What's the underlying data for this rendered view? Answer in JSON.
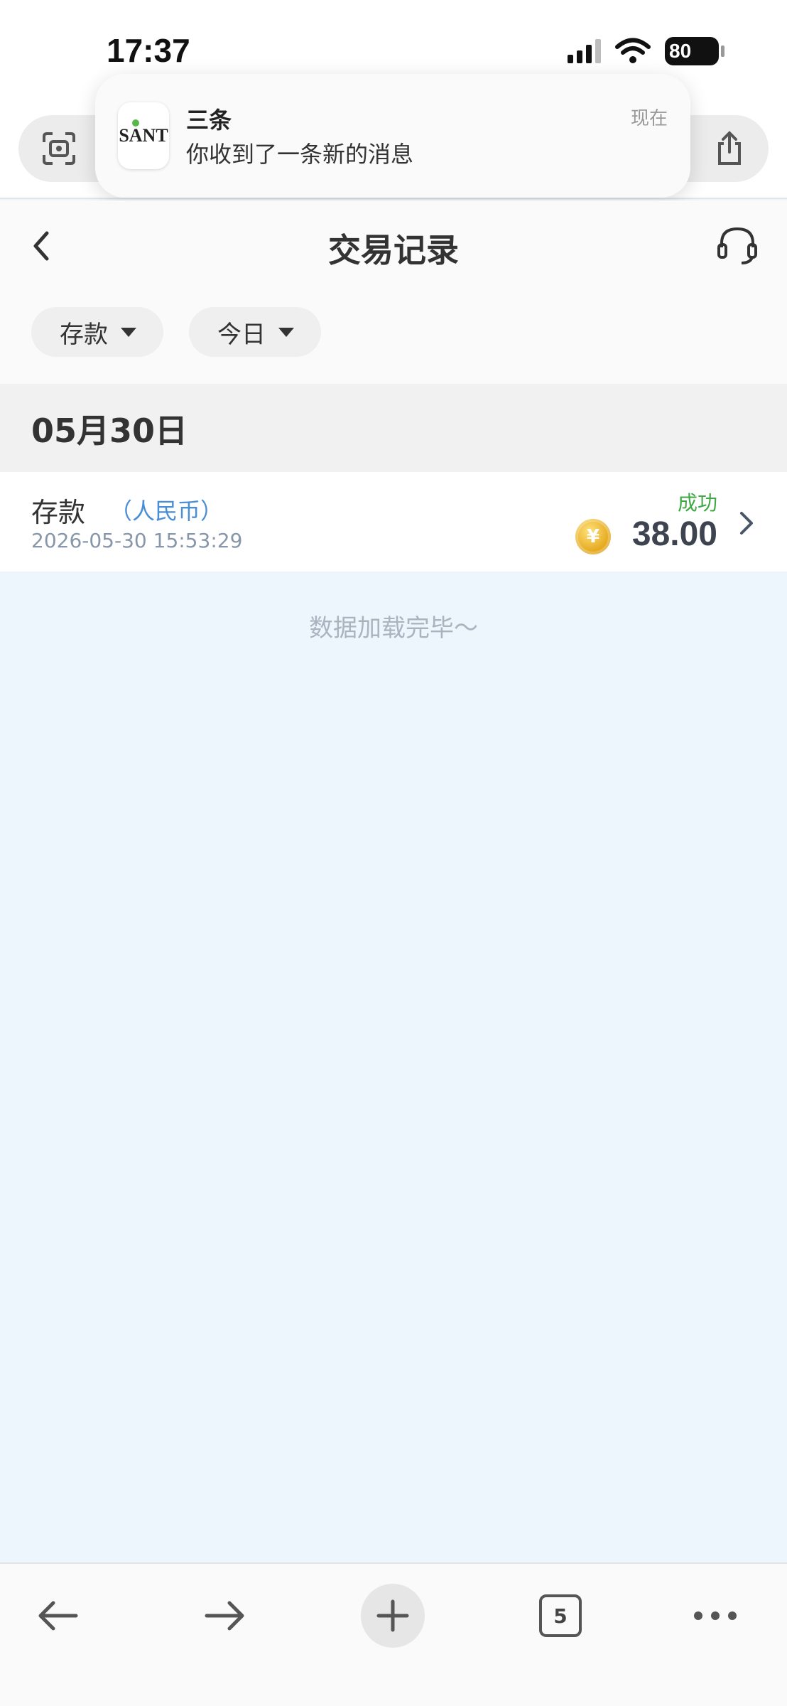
{
  "status_bar": {
    "time": "17:37",
    "battery": "80"
  },
  "notification": {
    "app_icon_text": "SANT",
    "app_name": "三条",
    "message": "你收到了一条新的消息",
    "time": "现在"
  },
  "header": {
    "title": "交易记录"
  },
  "filters": [
    {
      "label": "存款"
    },
    {
      "label": "今日"
    }
  ],
  "date_group": {
    "date": "05月30日"
  },
  "transactions": [
    {
      "type": "存款",
      "currency": "（人民币）",
      "datetime": "2026-05-30 15:53:29",
      "status": "成功",
      "coin_symbol": "¥",
      "amount": "38.00"
    }
  ],
  "end_message": "数据加载完毕～",
  "toolbar": {
    "tab_count": "5"
  },
  "colors": {
    "status_success": "#3ea844",
    "currency_text": "#4a8fd6",
    "page_background": "#eef6fd"
  }
}
